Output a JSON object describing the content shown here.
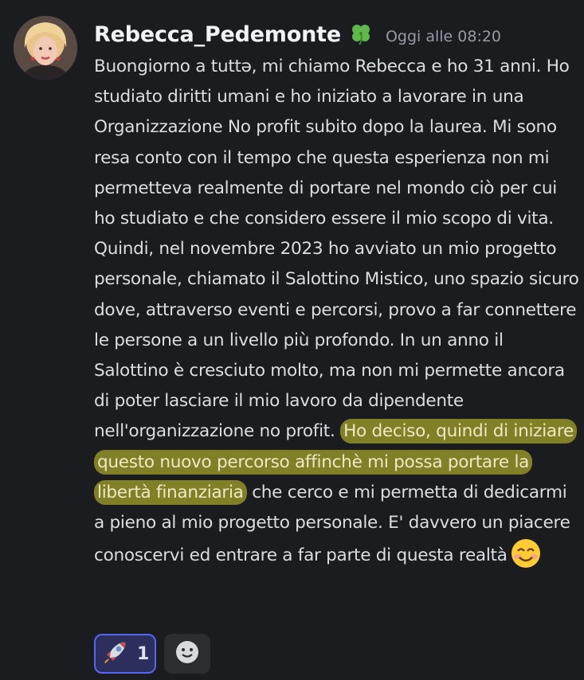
{
  "message": {
    "username": "Rebecca_Pedemonte",
    "username_icon": "four-leaf-clover-icon",
    "timestamp": "Oggi alle 08:20",
    "text_before": "Buongiorno a tuttə, mi chiamo Rebecca e ho 31 anni. Ho studiato diritti umani e ho iniziato a lavorare in una Organizzazione No profit subito dopo la laurea. Mi sono resa conto con il tempo che questa esperienza non mi permetteva realmente di portare nel mondo ciò per cui ho studiato e che considero essere il mio scopo di vita. Quindi, nel novembre 2023 ho avviato un mio progetto personale, chiamato il Salottino Mistico, uno spazio sicuro dove, attraverso eventi e percorsi, provo a far connettere le persone a un livello più profondo. In un anno il Salottino è cresciuto molto, ma non mi permette ancora di poter lasciare il mio lavoro da dipendente nell'organizzazione no profit. ",
    "text_highlighted": "Ho deciso, quindi di iniziare questo nuovo percorso affinchè mi possa portare la libertà finanziaria",
    "text_after": " che cerco e mi permetta di dedicarmi a pieno al mio progetto personale. E' davvero un piacere conoscervi ed entrare a far parte di questa realtà",
    "trailing_emoji": "smiling-face-with-smiling-eyes-icon",
    "highlight_color": "#9a9628"
  },
  "reactions": [
    {
      "icon": "rocket-icon",
      "count": "1",
      "active": true
    },
    {
      "icon": "add-reaction-icon",
      "active": false
    }
  ],
  "colors": {
    "background": "#1b1c20",
    "text": "#dbdee1",
    "username": "#f2f3f5",
    "timestamp": "#949ba4",
    "reaction_active_border": "#5865f2"
  }
}
